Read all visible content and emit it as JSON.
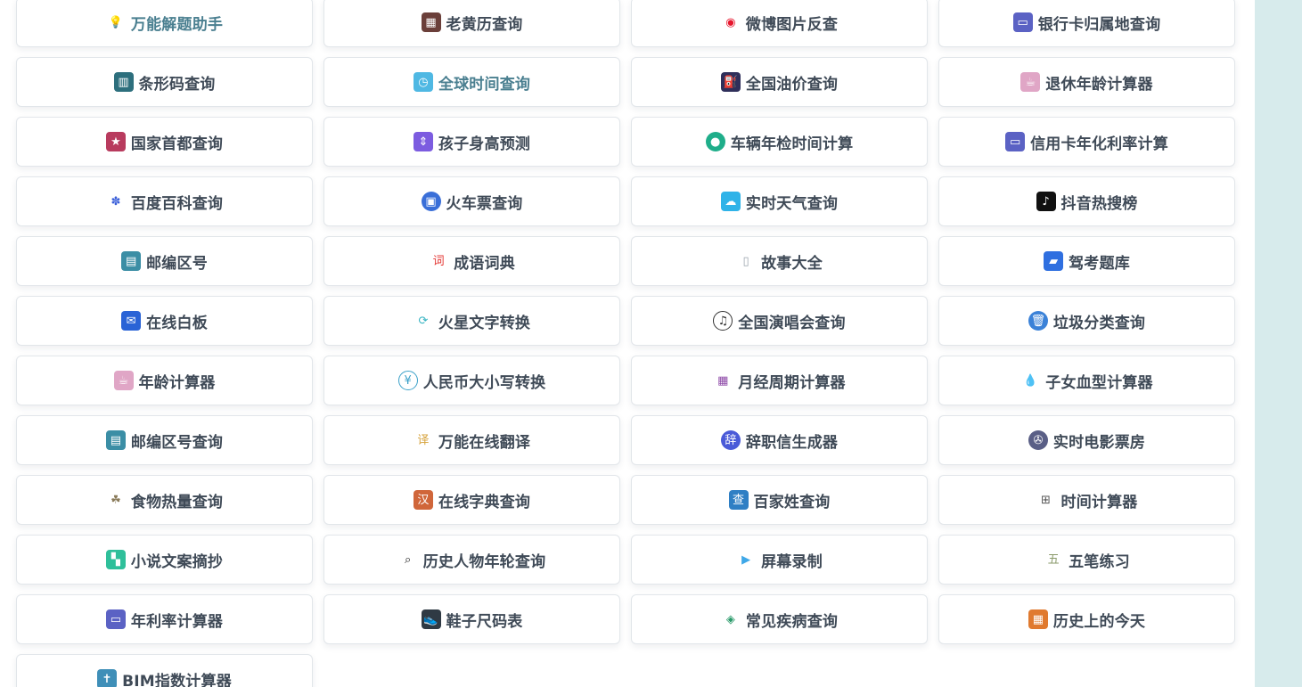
{
  "tools": [
    {
      "label": "万能解题助手",
      "icon": "lightbulb-icon",
      "color": "#f5b731",
      "glyph": "💡",
      "style": "plain",
      "accent": true
    },
    {
      "label": "老黄历查询",
      "icon": "almanac-icon",
      "color": "#6b3f3a",
      "glyph": "▦",
      "style": "square"
    },
    {
      "label": "微博图片反查",
      "icon": "weibo-icon",
      "color": "#e6162d",
      "glyph": "◉",
      "style": "plain"
    },
    {
      "label": "银行卡归属地查询",
      "icon": "bank-card-icon",
      "color": "#5b62c4",
      "glyph": "▭",
      "style": "square"
    },
    {
      "label": "条形码查询",
      "icon": "barcode-icon",
      "color": "#2d6f7d",
      "glyph": "▥",
      "style": "square"
    },
    {
      "label": "全球时间查询",
      "icon": "clock-icon",
      "color": "#4fb8e3",
      "glyph": "◷",
      "style": "square",
      "accent": true
    },
    {
      "label": "全国油价查询",
      "icon": "fuel-pump-icon",
      "color": "#2f2f5a",
      "glyph": "⛽",
      "style": "square"
    },
    {
      "label": "退休年龄计算器",
      "icon": "coffee-cup-icon",
      "color": "#e0a6c6",
      "glyph": "☕",
      "style": "square"
    },
    {
      "label": "国家首都查询",
      "icon": "star-icon",
      "color": "#b83b5e",
      "glyph": "★",
      "style": "square"
    },
    {
      "label": "孩子身高预测",
      "icon": "height-icon",
      "color": "#7c5ce0",
      "glyph": "⇕",
      "style": "square"
    },
    {
      "label": "车辆年检时间计算",
      "icon": "car-icon",
      "color": "#1fae8a",
      "glyph": "●",
      "style": "round"
    },
    {
      "label": "信用卡年化利率计算",
      "icon": "credit-card-icon",
      "color": "#5b62c4",
      "glyph": "▭",
      "style": "square"
    },
    {
      "label": "百度百科查询",
      "icon": "paw-icon",
      "color": "#3b5fd9",
      "glyph": "✽",
      "style": "plain"
    },
    {
      "label": "火车票查询",
      "icon": "train-icon",
      "color": "#3a6fd8",
      "glyph": "▣",
      "style": "round"
    },
    {
      "label": "实时天气查询",
      "icon": "weather-icon",
      "color": "#2fb3e8",
      "glyph": "☁",
      "style": "square"
    },
    {
      "label": "抖音热搜榜",
      "icon": "douyin-icon",
      "color": "#111111",
      "glyph": "♪",
      "style": "square"
    },
    {
      "label": "邮编区号",
      "icon": "postcode-icon",
      "color": "#3b8ea5",
      "glyph": "▤",
      "style": "square"
    },
    {
      "label": "成语词典",
      "icon": "dictionary-icon",
      "color": "#e3322f",
      "glyph": "词",
      "style": "plain"
    },
    {
      "label": "故事大全",
      "icon": "book-icon",
      "color": "#9aa3ad",
      "glyph": "▯",
      "style": "plain"
    },
    {
      "label": "驾考题库",
      "icon": "driving-test-icon",
      "color": "#2f6fe0",
      "glyph": "▰",
      "style": "square"
    },
    {
      "label": "在线白板",
      "icon": "whiteboard-icon",
      "color": "#2a63d6",
      "glyph": "✉",
      "style": "square"
    },
    {
      "label": "火星文字转换",
      "icon": "refresh-icon",
      "color": "#36b3c2",
      "glyph": "⟳",
      "style": "plain"
    },
    {
      "label": "全国演唱会查询",
      "icon": "music-disc-icon",
      "color": "#333333",
      "glyph": "♫",
      "style": "outline-round"
    },
    {
      "label": "垃圾分类查询",
      "icon": "trash-icon",
      "color": "#3b82d8",
      "glyph": "🗑",
      "style": "round"
    },
    {
      "label": "年龄计算器",
      "icon": "coffee-cup-icon",
      "color": "#e0a6c6",
      "glyph": "☕",
      "style": "square"
    },
    {
      "label": "人民币大小写转换",
      "icon": "yuan-icon",
      "color": "#3aa0c8",
      "glyph": "¥",
      "style": "outline-round"
    },
    {
      "label": "月经周期计算器",
      "icon": "calendar-icon",
      "color": "#8e4aa8",
      "glyph": "▦",
      "style": "plain"
    },
    {
      "label": "子女血型计算器",
      "icon": "blood-drop-icon",
      "color": "#3a8ad8",
      "glyph": "💧",
      "style": "plain"
    },
    {
      "label": "邮编区号查询",
      "icon": "postcode-icon",
      "color": "#3b8ea5",
      "glyph": "▤",
      "style": "square"
    },
    {
      "label": "万能在线翻译",
      "icon": "translate-icon",
      "color": "#d6a23a",
      "glyph": "译",
      "style": "plain"
    },
    {
      "label": "辞职信生成器",
      "icon": "resign-letter-icon",
      "color": "#4a5ad8",
      "glyph": "辞",
      "style": "round"
    },
    {
      "label": "实时电影票房",
      "icon": "film-reel-icon",
      "color": "#5a5f86",
      "glyph": "✇",
      "style": "round"
    },
    {
      "label": "食物热量查询",
      "icon": "food-icon",
      "color": "#8a7b5a",
      "glyph": "☘",
      "style": "plain"
    },
    {
      "label": "在线字典查询",
      "icon": "han-character-icon",
      "color": "#d0663a",
      "glyph": "汉",
      "style": "square"
    },
    {
      "label": "百家姓查询",
      "icon": "surname-icon",
      "color": "#2f7fc4",
      "glyph": "查",
      "style": "square"
    },
    {
      "label": "时间计算器",
      "icon": "calculator-icon",
      "color": "#555555",
      "glyph": "⊞",
      "style": "plain"
    },
    {
      "label": "小说文案摘抄",
      "icon": "novel-icon",
      "color": "#2fbf9a",
      "glyph": "▚",
      "style": "square"
    },
    {
      "label": "历史人物年轮查询",
      "icon": "search-icon",
      "color": "#222222",
      "glyph": "⌕",
      "style": "plain"
    },
    {
      "label": "屏幕录制",
      "icon": "video-camera-icon",
      "color": "#3fa8e8",
      "glyph": "▶",
      "style": "plain"
    },
    {
      "label": "五笔练习",
      "icon": "wubi-icon",
      "color": "#8a9a6a",
      "glyph": "五",
      "style": "plain"
    },
    {
      "label": "年利率计算器",
      "icon": "credit-card-icon",
      "color": "#5b62c4",
      "glyph": "▭",
      "style": "square"
    },
    {
      "label": "鞋子尺码表",
      "icon": "shoe-icon",
      "color": "#2f3a44",
      "glyph": "👟",
      "style": "square"
    },
    {
      "label": "常见疾病查询",
      "icon": "graduation-cap-icon",
      "color": "#2a9a6a",
      "glyph": "◈",
      "style": "plain"
    },
    {
      "label": "历史上的今天",
      "icon": "history-calendar-icon",
      "color": "#e07a2f",
      "glyph": "▦",
      "style": "square"
    },
    {
      "label": "BIM指数计算器",
      "icon": "body-icon",
      "color": "#3f8fb8",
      "glyph": "✝",
      "style": "square"
    }
  ]
}
